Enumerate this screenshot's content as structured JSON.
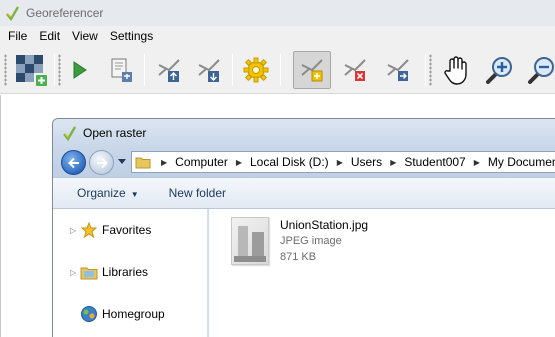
{
  "window": {
    "title": "Georeferencer",
    "icon": "qgis-logo-icon"
  },
  "menubar": {
    "items": [
      "File",
      "Edit",
      "View",
      "Settings"
    ]
  },
  "toolbar": {
    "buttons": [
      {
        "name": "open-raster",
        "icon": "open-raster-grid-icon"
      },
      {
        "name": "start-georeferencing",
        "icon": "play-icon"
      },
      {
        "name": "generate-gdal-script",
        "icon": "gdal-script-icon"
      },
      {
        "name": "load-gcp-points",
        "icon": "load-gcp-icon"
      },
      {
        "name": "save-gcp-points",
        "icon": "save-gcp-icon"
      },
      {
        "name": "transformation-settings",
        "icon": "gear-icon"
      },
      {
        "name": "add-point",
        "icon": "add-point-icon"
      },
      {
        "name": "delete-point",
        "icon": "delete-point-icon"
      },
      {
        "name": "move-gcp-point",
        "icon": "move-point-icon"
      },
      {
        "name": "pan",
        "icon": "hand-icon"
      },
      {
        "name": "zoom-in",
        "icon": "zoom-in-icon"
      },
      {
        "name": "zoom-out",
        "icon": "zoom-out-icon"
      }
    ],
    "active_button": "add-point"
  },
  "dialog": {
    "title": "Open raster",
    "icon": "qgis-logo-icon",
    "breadcrumbs": [
      "Computer",
      "Local Disk (D:)",
      "Users",
      "Student007",
      "My Documents"
    ],
    "commands": {
      "organize": "Organize",
      "new_folder": "New folder"
    },
    "nav_pane": {
      "items": [
        {
          "label": "Favorites",
          "icon": "star-icon",
          "expandable": true
        },
        {
          "label": "Libraries",
          "icon": "libraries-icon",
          "expandable": true
        },
        {
          "label": "Homegroup",
          "icon": "homegroup-icon",
          "expandable": false
        }
      ]
    },
    "files": [
      {
        "name": "UnionStation.jpg",
        "type": "JPEG image",
        "size": "871 KB"
      }
    ]
  }
}
